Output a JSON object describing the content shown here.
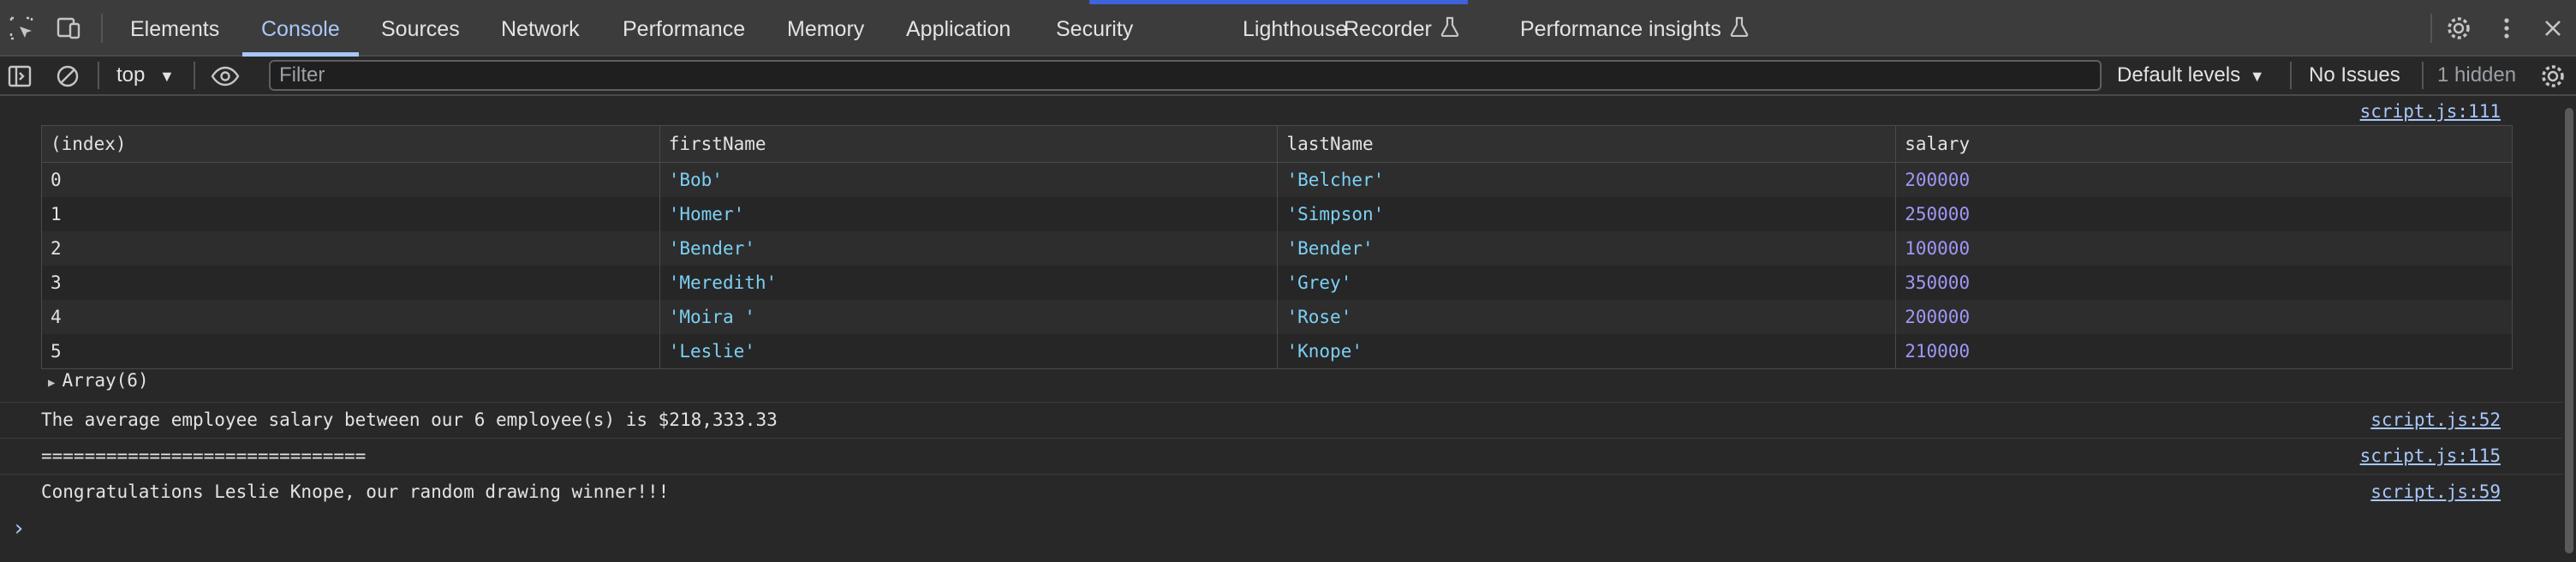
{
  "tabs": [
    {
      "label": "Elements"
    },
    {
      "label": "Console"
    },
    {
      "label": "Sources"
    },
    {
      "label": "Network"
    },
    {
      "label": "Performance"
    },
    {
      "label": "Memory"
    },
    {
      "label": "Application"
    },
    {
      "label": "Security"
    },
    {
      "label": "Lighthouse"
    },
    {
      "label": "Recorder"
    },
    {
      "label": "Performance insights"
    }
  ],
  "active_tab": "Console",
  "toolbar": {
    "context": "top",
    "filter_placeholder": "Filter",
    "levels": "Default levels",
    "issues": "No Issues",
    "hidden": "1 hidden"
  },
  "console": {
    "table_source": "script.js:111",
    "table": {
      "headers": [
        "(index)",
        "firstName",
        "lastName",
        "salary"
      ],
      "rows": [
        {
          "index": "0",
          "firstName": "'Bob'",
          "lastName": "'Belcher'",
          "salary": "200000"
        },
        {
          "index": "1",
          "firstName": "'Homer'",
          "lastName": "'Simpson'",
          "salary": "250000"
        },
        {
          "index": "2",
          "firstName": "'Bender'",
          "lastName": "'Bender'",
          "salary": "100000"
        },
        {
          "index": "3",
          "firstName": "'Meredith'",
          "lastName": "'Grey'",
          "salary": "350000"
        },
        {
          "index": "4",
          "firstName": "'Moira '",
          "lastName": "'Rose'",
          "salary": "200000"
        },
        {
          "index": "5",
          "firstName": "'Leslie'",
          "lastName": "'Knope'",
          "salary": "210000"
        }
      ]
    },
    "array_label": "Array(6)",
    "messages": [
      {
        "text": "The average employee salary between our 6 employee(s) is $218,333.33",
        "source": "script.js:52"
      },
      {
        "text": "==============================",
        "source": "script.js:115"
      },
      {
        "text": "Congratulations Leslie Knope, our random drawing winner!!!",
        "source": "script.js:59"
      }
    ],
    "prompt": "›"
  },
  "colors": {
    "string": "#7cd0f4",
    "number": "#9f97f6",
    "link": "#a8c7fa",
    "active_tab": "#a8c7fa"
  }
}
